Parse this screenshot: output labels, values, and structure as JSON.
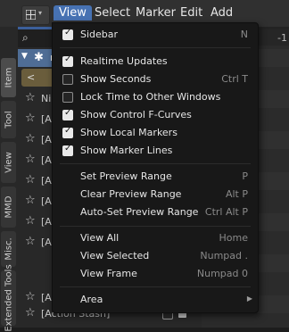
{
  "menubar": {
    "items": [
      "View",
      "Select",
      "Marker",
      "Edit",
      "Add"
    ],
    "active": "View"
  },
  "side_tabs": [
    "Item",
    "Tool",
    "View",
    "MMD",
    "Misc.",
    "Extended Tools"
  ],
  "list": {
    "summary_label": "m",
    "action_row": "<",
    "rows": [
      {
        "label": "Ni"
      },
      {
        "label": "[A"
      },
      {
        "label": "[A"
      },
      {
        "label": "[A"
      },
      {
        "label": "[A"
      },
      {
        "label": "[A"
      },
      {
        "label": "[A"
      },
      {
        "label": "[A"
      },
      {
        "label": "[A"
      },
      {
        "label": "[Action Stash]"
      }
    ]
  },
  "timeline": {
    "ruler_number": "-1"
  },
  "view_menu": {
    "items": [
      {
        "label": "Sidebar",
        "shortcut": "N",
        "checkbox": true,
        "checked": true
      },
      {
        "separator": true
      },
      {
        "label": "Realtime Updates",
        "shortcut": "",
        "checkbox": true,
        "checked": true
      },
      {
        "label": "Show Seconds",
        "shortcut": "Ctrl T",
        "checkbox": true,
        "checked": false
      },
      {
        "label": "Lock Time to Other Windows",
        "shortcut": "",
        "checkbox": true,
        "checked": false
      },
      {
        "label": "Show Control F-Curves",
        "shortcut": "",
        "checkbox": true,
        "checked": true
      },
      {
        "label": "Show Local Markers",
        "shortcut": "",
        "checkbox": true,
        "checked": true
      },
      {
        "label": "Show Marker Lines",
        "shortcut": "",
        "checkbox": true,
        "checked": true
      },
      {
        "separator": true
      },
      {
        "label": "Set Preview Range",
        "shortcut": "P"
      },
      {
        "label": "Clear Preview Range",
        "shortcut": "Alt P"
      },
      {
        "label": "Auto-Set Preview Range",
        "shortcut": "Ctrl Alt P"
      },
      {
        "separator": true
      },
      {
        "label": "View All",
        "shortcut": "Home"
      },
      {
        "label": "View Selected",
        "shortcut": "Numpad ."
      },
      {
        "label": "View Frame",
        "shortcut": "Numpad 0"
      },
      {
        "separator": true
      },
      {
        "label": "Area",
        "shortcut": "",
        "submenu": true
      }
    ]
  },
  "colors": {
    "menu_highlight": "#4772b3",
    "summary_row": "#4f6d95",
    "action_row": "#6a5d3c",
    "menu_bg": "#181818"
  }
}
